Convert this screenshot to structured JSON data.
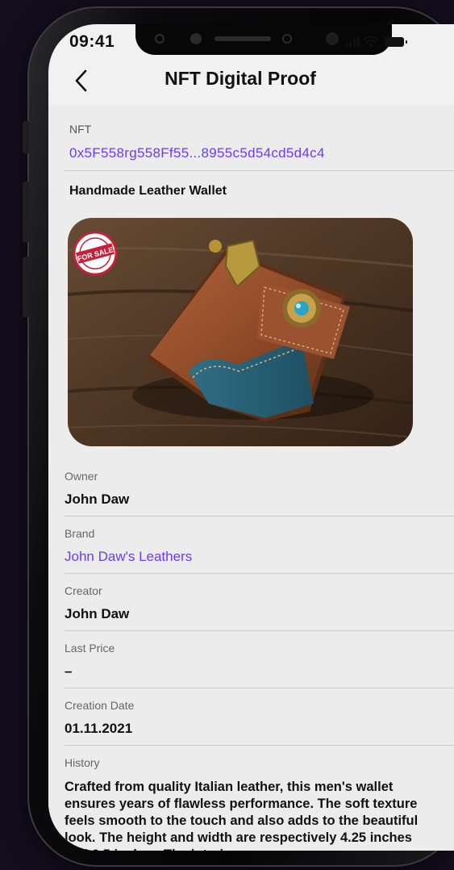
{
  "status_bar": {
    "time": "09:41"
  },
  "header": {
    "title": "NFT Digital Proof",
    "back_icon": "chevron-left-icon"
  },
  "nft": {
    "label": "NFT",
    "address": "0x5F558rg558Ff55...8955c5d54cd5d4c4"
  },
  "product": {
    "title": "Handmade Leather Wallet",
    "badge_text": "FOR SALE"
  },
  "fields": [
    {
      "label": "Owner",
      "value": "John Daw"
    },
    {
      "label": "Brand",
      "value": "John Daw's Leathers"
    },
    {
      "label": "Creator",
      "value": "John Daw"
    },
    {
      "label": "Last Price",
      "value": "–"
    },
    {
      "label": "Creation Date",
      "value": "01.11.2021"
    }
  ],
  "history": {
    "label": "History",
    "text": "Crafted from quality Italian leather, this men's wallet ensures years of flawless performance. The soft texture feels smooth to the touch and also adds to the beautiful look. The height and width are respectively 4.25 inches and 3.5 inches. The interi"
  },
  "colors": {
    "accent": "#6c3cf0",
    "background": "#140d1e",
    "screen": "#ececed"
  }
}
